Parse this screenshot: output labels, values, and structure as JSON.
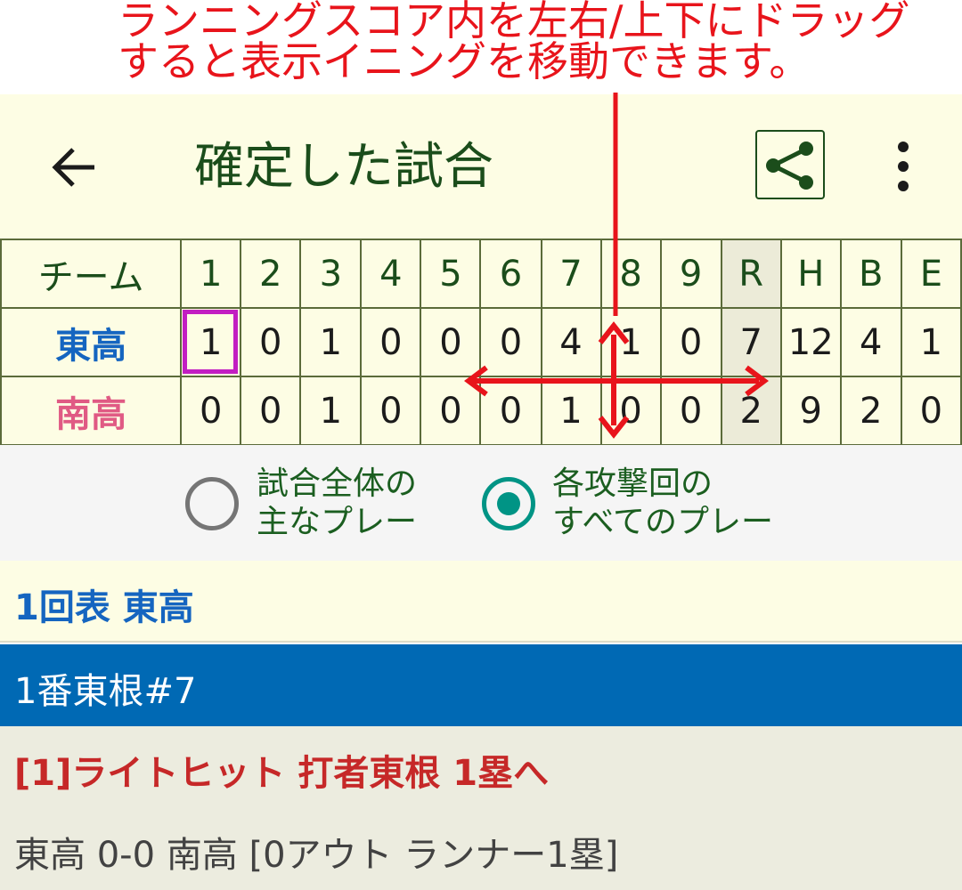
{
  "annotation": {
    "line1": "ランニングスコア内を左右/上下にドラッグ",
    "line2": "すると表示イニングを移動できます。"
  },
  "appbar": {
    "title": "確定した試合",
    "back_icon": "arrow-left-icon",
    "share_icon": "share-icon",
    "more_icon": "more-vertical-icon"
  },
  "scoreboard": {
    "header": [
      "チーム",
      "1",
      "2",
      "3",
      "4",
      "5",
      "6",
      "7",
      "8",
      "9",
      "R",
      "H",
      "B",
      "E"
    ],
    "rows": [
      {
        "team": "東高",
        "cells": [
          "1",
          "0",
          "1",
          "0",
          "0",
          "0",
          "4",
          "1",
          "0",
          "7",
          "12",
          "4",
          "1"
        ]
      },
      {
        "team": "南高",
        "cells": [
          "0",
          "0",
          "1",
          "0",
          "0",
          "0",
          "1",
          "0",
          "0",
          "2",
          "9",
          "2",
          "0"
        ]
      }
    ],
    "selected": {
      "team": "東高",
      "inning": "1"
    }
  },
  "view_options": [
    {
      "line1": "試合全体の",
      "line2": "主なプレー",
      "selected": false
    },
    {
      "line1": "各攻撃回の",
      "line2": "すべてのプレー",
      "selected": true
    }
  ],
  "inning_header": "1回表  東高",
  "batter": "1番東根#7",
  "play": "[1]ライトヒット 打者東根 1塁へ",
  "status": "東高 0-0 南高 [0アウト ランナー1塁]",
  "colors": {
    "annotation": "#e8141b",
    "appbar_bg": "#fdfde4",
    "title": "#1b4d1b",
    "team_east": "#1565c0",
    "team_south": "#e05a84",
    "selection": "#c21ec2",
    "radio_selected": "#009485",
    "batter_bar": "#0069b4",
    "play_text": "#c62828"
  }
}
